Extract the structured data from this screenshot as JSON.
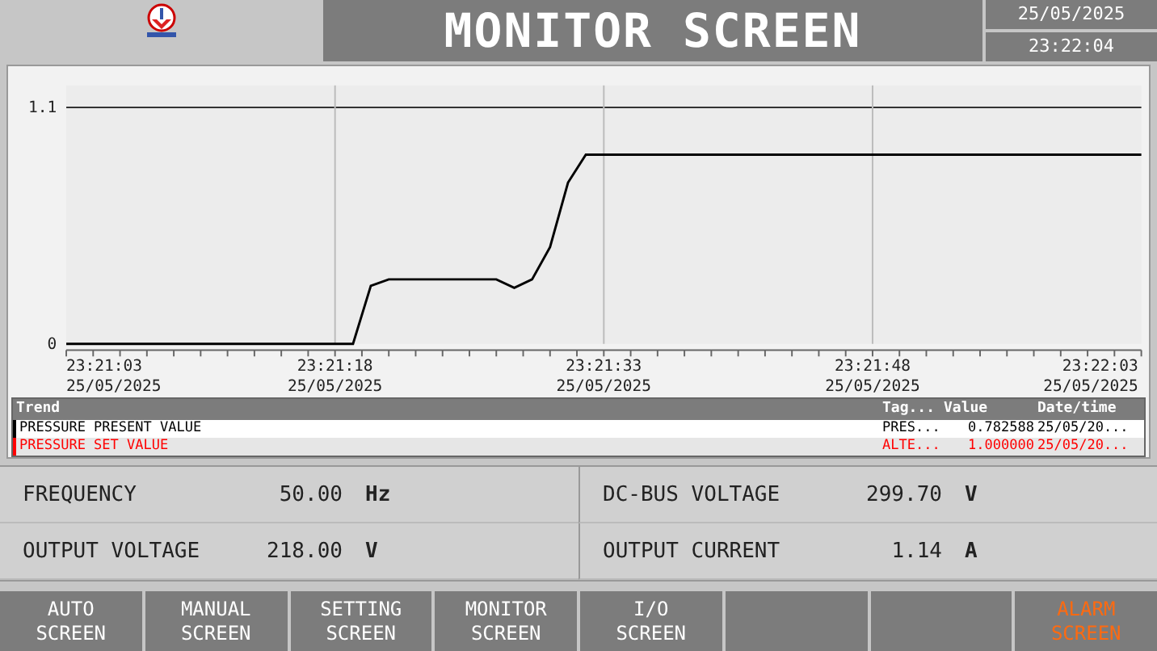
{
  "header": {
    "title": "MONITOR SCREEN",
    "date": "25/05/2025",
    "time": "23:22:04"
  },
  "trend": {
    "chart_data": {
      "type": "line",
      "categories": [
        "23:21:03 25/05/2025",
        null,
        null,
        null,
        null,
        null,
        null,
        null,
        null,
        null,
        null,
        null,
        null,
        null,
        null,
        "23:21:18 25/05/2025",
        null,
        null,
        null,
        null,
        null,
        null,
        null,
        null,
        null,
        null,
        null,
        null,
        null,
        null,
        "23:21:33 25/05/2025",
        null,
        null,
        null,
        null,
        null,
        null,
        null,
        null,
        null,
        null,
        null,
        null,
        null,
        null,
        "23:21:48 25/05/2025",
        null,
        null,
        null,
        null,
        null,
        null,
        null,
        null,
        null,
        null,
        null,
        null,
        null,
        null,
        "23:22:03 25/05/2025"
      ],
      "series": [
        {
          "name": "PRESSURE PRESENT VALUE",
          "color": "#000000",
          "values": [
            0,
            0,
            0,
            0,
            0,
            0,
            0,
            0,
            0,
            0,
            0,
            0,
            0,
            0,
            0,
            0,
            0,
            0.27,
            0.3,
            0.3,
            0.3,
            0.3,
            0.3,
            0.3,
            0.3,
            0.26,
            0.3,
            0.45,
            0.75,
            0.88,
            0.88,
            0.88,
            0.88,
            0.88,
            0.88,
            0.88,
            0.88,
            0.88,
            0.88,
            0.88,
            0.88,
            0.88,
            0.88,
            0.88,
            0.88,
            0.88,
            0.88,
            0.88,
            0.88,
            0.88,
            0.88,
            0.88,
            0.88,
            0.88,
            0.88,
            0.88,
            0.88,
            0.88,
            0.88,
            0.88,
            0.88
          ]
        }
      ],
      "ylim": [
        0,
        1.1
      ],
      "yticks": [
        0,
        1.1
      ]
    },
    "legend": {
      "columns": [
        "Trend",
        "Tag...",
        "Value",
        "Date/time"
      ],
      "rows": [
        {
          "kind": "plotted",
          "tag": "PRES...",
          "value": "0.782588",
          "datetime": "25/05/20...",
          "color": "#000000"
        },
        {
          "kind": "unplotted",
          "name": "PRESSURE SET VALUE",
          "tag": "ALTE...",
          "value": "1.000000",
          "datetime": "25/05/20...",
          "color": "#ff0000"
        }
      ]
    }
  },
  "readings": [
    {
      "label": "FREQUENCY",
      "value": "50.00",
      "unit": "Hz"
    },
    {
      "label": "DC-BUS VOLTAGE",
      "value": "299.70",
      "unit": "V"
    },
    {
      "label": "OUTPUT VOLTAGE",
      "value": "218.00",
      "unit": "V"
    },
    {
      "label": "OUTPUT CURRENT",
      "value": "1.14",
      "unit": "A"
    }
  ],
  "nav_buttons": [
    {
      "kind": "label",
      "lines": [
        "AUTO",
        "SCREEN"
      ],
      "alarm": false
    },
    {
      "kind": "label",
      "lines": [
        "MANUAL",
        "SCREEN"
      ],
      "alarm": false
    },
    {
      "kind": "label",
      "lines": [
        "SETTING",
        "SCREEN"
      ],
      "alarm": false
    },
    {
      "kind": "label",
      "lines": [
        "MONITOR",
        "SCREEN"
      ],
      "alarm": false
    },
    {
      "kind": "label",
      "lines": [
        "I/O",
        "SCREEN"
      ],
      "alarm": false
    },
    {
      "kind": "blank"
    },
    {
      "kind": "blank"
    },
    {
      "kind": "label",
      "lines": [
        "ALARM",
        "SCREEN"
      ],
      "alarm": true
    }
  ]
}
